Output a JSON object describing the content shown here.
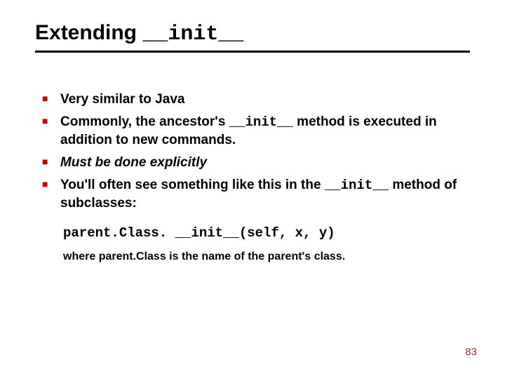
{
  "title": {
    "prefix": "Extending ",
    "mono": "__init__"
  },
  "bullets": {
    "b1": "Very similar to Java",
    "b2": {
      "pre": "Commonly, the ancestor's ",
      "mono": "__init__",
      "post": " method is executed in addition to new commands."
    },
    "b3": "Must be done explicitly",
    "b4": {
      "pre": "You'll often see something like this in the ",
      "mono": "__init__",
      "post": " method of subclasses:"
    }
  },
  "code": "parent.Class. __init__(self, x, y)",
  "footer": "where parent.Class is the name of the parent's class.",
  "page": "83"
}
